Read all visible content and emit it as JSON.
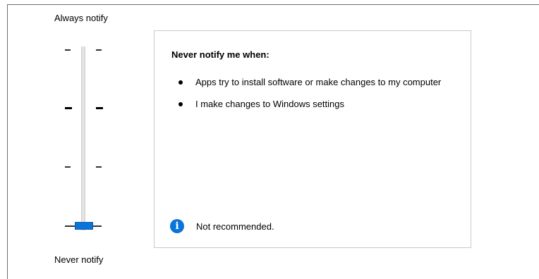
{
  "slider": {
    "top_label": "Always notify",
    "bottom_label": "Never notify",
    "level_count": 4,
    "selected_level": 1,
    "thumb_color": "#0a74d8"
  },
  "info": {
    "heading": "Never notify me when:",
    "items": [
      "Apps try to install software or make changes to my computer",
      "I make changes to Windows settings"
    ],
    "recommendation": "Not recommended.",
    "icon": "info-icon",
    "icon_glyph": "i",
    "icon_color": "#0a74d8"
  }
}
